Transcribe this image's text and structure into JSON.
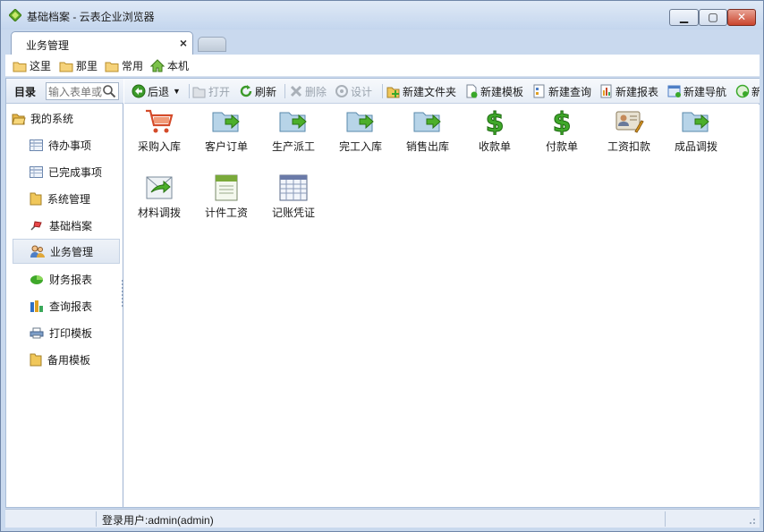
{
  "window": {
    "title": "基础档案 - 云表企业浏览器",
    "min_icon": "minimize-icon",
    "max_icon": "maximize-icon",
    "close_icon": "close-icon"
  },
  "tabs": [
    {
      "label": "业务管理",
      "close": "×"
    }
  ],
  "bookmarks": [
    {
      "label": "这里",
      "icon": "folder-icon"
    },
    {
      "label": "那里",
      "icon": "folder-icon"
    },
    {
      "label": "常用",
      "icon": "folder-icon"
    },
    {
      "label": "本机",
      "icon": "home-icon"
    }
  ],
  "sidebar": {
    "title": "目录",
    "search_placeholder": "输入表单或",
    "root": "我的系统",
    "items": [
      {
        "label": "待办事项",
        "icon": "table-icon"
      },
      {
        "label": "已完成事项",
        "icon": "table-icon"
      },
      {
        "label": "系统管理",
        "icon": "folder-icon"
      },
      {
        "label": "基础档案",
        "icon": "pushpin-icon"
      },
      {
        "label": "业务管理",
        "icon": "users-icon",
        "selected": true
      },
      {
        "label": "财务报表",
        "icon": "pie-chart-icon"
      },
      {
        "label": "查询报表",
        "icon": "bar-chart-icon"
      },
      {
        "label": "打印模板",
        "icon": "printer-icon"
      },
      {
        "label": "备用模板",
        "icon": "folder-icon"
      }
    ]
  },
  "toolbar": {
    "back": "后退",
    "open": "打开",
    "refresh": "刷新",
    "delete": "删除",
    "design": "设计",
    "new_folder": "新建文件夹",
    "new_template": "新建模板",
    "new_query": "新建查询",
    "new_report": "新建报表",
    "new_nav": "新建导航",
    "new_more": "新"
  },
  "content": {
    "items": [
      {
        "label": "采购入库",
        "icon": "shopping-cart-icon"
      },
      {
        "label": "客户订单",
        "icon": "folder-arrow-icon"
      },
      {
        "label": "生产派工",
        "icon": "folder-arrow-icon"
      },
      {
        "label": "完工入库",
        "icon": "folder-arrow-icon"
      },
      {
        "label": "销售出库",
        "icon": "folder-arrow-icon"
      },
      {
        "label": "收款单",
        "icon": "dollar-icon"
      },
      {
        "label": "付款单",
        "icon": "dollar-icon"
      },
      {
        "label": "工资扣款",
        "icon": "id-card-icon"
      },
      {
        "label": "成品调拨",
        "icon": "folder-arrow-icon"
      },
      {
        "label": "材料调拨",
        "icon": "mail-arrow-icon"
      },
      {
        "label": "计件工资",
        "icon": "xml-document-icon"
      },
      {
        "label": "记账凭证",
        "icon": "spreadsheet-icon"
      }
    ]
  },
  "status": {
    "user": "登录用户:admin(admin)"
  }
}
